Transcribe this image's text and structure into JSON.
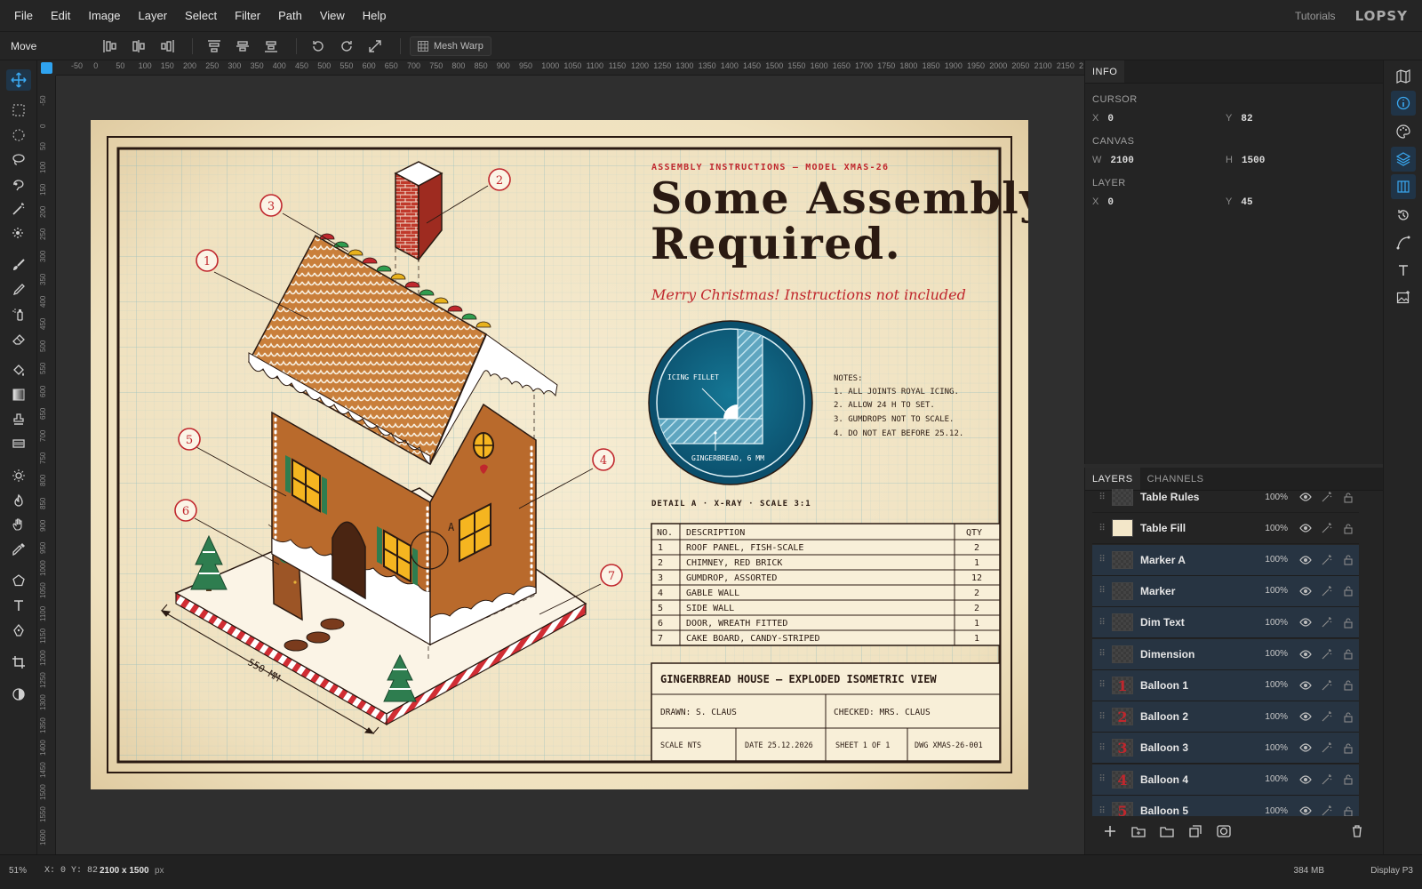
{
  "menubar": {
    "items": [
      "File",
      "Edit",
      "Image",
      "Layer",
      "Select",
      "Filter",
      "Path",
      "View",
      "Help"
    ],
    "tutorials": "Tutorials",
    "logo": "LOPSY"
  },
  "options": {
    "tool_name": "Move",
    "mesh_warp": "Mesh Warp"
  },
  "rulers": {
    "top": [
      "-50",
      "0",
      "50",
      "100",
      "150",
      "200",
      "250",
      "300",
      "350",
      "400",
      "450",
      "500",
      "550",
      "600",
      "650",
      "700",
      "750",
      "800",
      "850",
      "900",
      "950",
      "1000",
      "1050",
      "1100",
      "1150",
      "1200",
      "1250",
      "1300",
      "1350",
      "1400",
      "1450",
      "1500",
      "1550",
      "1600",
      "1650",
      "1700",
      "1750",
      "1800",
      "1850",
      "1900",
      "1950",
      "2000",
      "2050",
      "2100",
      "2150",
      "2"
    ],
    "left": [
      "-50",
      "0",
      "50",
      "100",
      "150",
      "200",
      "250",
      "300",
      "350",
      "400",
      "450",
      "500",
      "550",
      "600",
      "650",
      "700",
      "750",
      "800",
      "850",
      "900",
      "950",
      "1000",
      "1050",
      "1100",
      "1150",
      "1200",
      "1250",
      "1300",
      "1350",
      "1400",
      "1450",
      "1500",
      "1550",
      "1600"
    ]
  },
  "drawing": {
    "kicker": "ASSEMBLY INSTRUCTIONS — MODEL XMAS-26",
    "title_line1": "Some Assembly",
    "title_line2": "Required.",
    "subtitle": "Merry Christmas! Instructions not included",
    "detail_fillet": "ICING FILLET",
    "detail_gingerbread": "GINGERBREAD, 6 MM",
    "detail_caption": "DETAIL A · X-RAY · SCALE 3:1",
    "detail_marker": "A",
    "dimension": "550 MM",
    "notes_title": "NOTES:",
    "notes": [
      "1. ALL JOINTS ROYAL ICING.",
      "2. ALLOW 24 H TO SET.",
      "3. GUMDROPS NOT TO SCALE.",
      "4. DO NOT EAT BEFORE 25.12."
    ],
    "table_headers": [
      "NO.",
      "DESCRIPTION",
      "QTY"
    ],
    "table_rows": [
      [
        "1",
        "ROOF PANEL, FISH-SCALE",
        "2"
      ],
      [
        "2",
        "CHIMNEY, RED BRICK",
        "1"
      ],
      [
        "3",
        "GUMDROP, ASSORTED",
        "12"
      ],
      [
        "4",
        "GABLE WALL",
        "2"
      ],
      [
        "5",
        "SIDE WALL",
        "2"
      ],
      [
        "6",
        "DOOR, WREATH FITTED",
        "1"
      ],
      [
        "7",
        "CAKE BOARD, CANDY-STRIPED",
        "1"
      ]
    ],
    "title_block": {
      "name": "GINGERBREAD HOUSE — EXPLODED ISOMETRIC VIEW",
      "drawn": "DRAWN: S. CLAUS",
      "checked": "CHECKED: MRS. CLAUS",
      "scale": "SCALE NTS",
      "date": "DATE 25.12.2026",
      "sheet": "SHEET 1 OF 1",
      "dwg": "DWG XMAS-26-001"
    },
    "balloons": [
      "1",
      "2",
      "3",
      "4",
      "5",
      "6",
      "7"
    ]
  },
  "info": {
    "tab": "INFO",
    "cursor_label": "CURSOR",
    "cursor_x_label": "X",
    "cursor_x": "0",
    "cursor_y_label": "Y",
    "cursor_y": "82",
    "canvas_label": "CANVAS",
    "canvas_w_label": "W",
    "canvas_w": "2100",
    "canvas_h_label": "H",
    "canvas_h": "1500",
    "layer_label": "LAYER",
    "layer_x_label": "X",
    "layer_x": "0",
    "layer_y_label": "Y",
    "layer_y": "45"
  },
  "layers": {
    "tabs": [
      "LAYERS",
      "CHANNELS"
    ],
    "items": [
      {
        "name": "Table Rules",
        "opacity": "100%",
        "glyph": ""
      },
      {
        "name": "Table Fill",
        "opacity": "100%",
        "glyph": ""
      },
      {
        "name": "Marker A",
        "opacity": "100%",
        "glyph": ""
      },
      {
        "name": "Marker",
        "opacity": "100%",
        "glyph": ""
      },
      {
        "name": "Dim Text",
        "opacity": "100%",
        "glyph": ""
      },
      {
        "name": "Dimension",
        "opacity": "100%",
        "glyph": ""
      },
      {
        "name": "Balloon 1",
        "opacity": "100%",
        "glyph": "1"
      },
      {
        "name": "Balloon 2",
        "opacity": "100%",
        "glyph": "2"
      },
      {
        "name": "Balloon 3",
        "opacity": "100%",
        "glyph": "3"
      },
      {
        "name": "Balloon 4",
        "opacity": "100%",
        "glyph": "4"
      },
      {
        "name": "Balloon 5",
        "opacity": "100%",
        "glyph": "5"
      }
    ]
  },
  "status": {
    "zoom": "51%",
    "coords": "X: 0 Y: 82",
    "size": "2100 x 1500",
    "size_unit": "px",
    "memory": "384 MB",
    "profile": "Display P3"
  },
  "colors": {
    "accent": "#2fa3f0",
    "paper": "#f3e7c9",
    "ink": "#2a1a12",
    "red": "#c0272d",
    "teal": "#0b5a7a"
  }
}
